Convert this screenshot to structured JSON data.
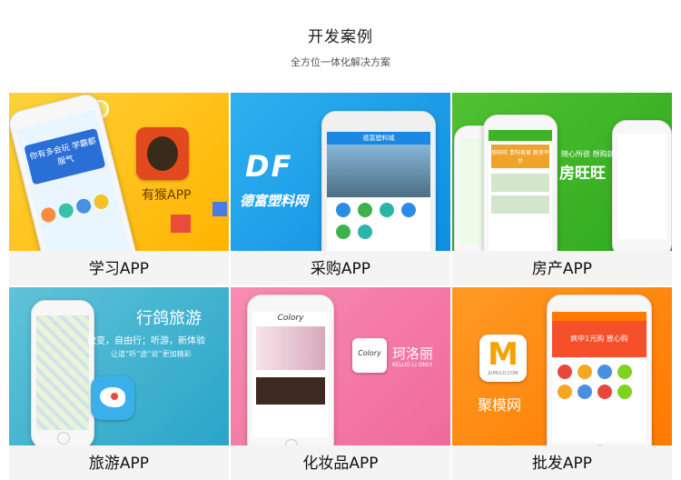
{
  "header": {
    "title": "开发案例",
    "subtitle": "全方位一体化解决方案"
  },
  "cases": [
    {
      "caption": "学习APP",
      "app_label": "有猴APP",
      "screen_banner": "你有多会玩 学霸都服气"
    },
    {
      "caption": "采购APP",
      "logo_text": "DF",
      "brand": "德富塑料网",
      "screen_title": "德富塑料城"
    },
    {
      "caption": "房产APP",
      "brand": "房旺旺",
      "tagline": "随心所欲 想购就购",
      "screen_banner": "房旺旺 贵阳首家 新房平台"
    },
    {
      "caption": "旅游APP",
      "brand": "行鸽旅游",
      "tagline": "改变，自由行；听游，新体验",
      "tagline2": "让道“听”途“说”更加精彩"
    },
    {
      "caption": "化妆品APP",
      "brand": "珂洛丽",
      "brand_en": "KELUO LI ONLY",
      "logo_text": "Colory"
    },
    {
      "caption": "批发APP",
      "brand": "聚模网",
      "logo_text": "M",
      "logo_sub": "JUMULD.COM",
      "screen_banner": "疯中1元购 放心购"
    }
  ]
}
